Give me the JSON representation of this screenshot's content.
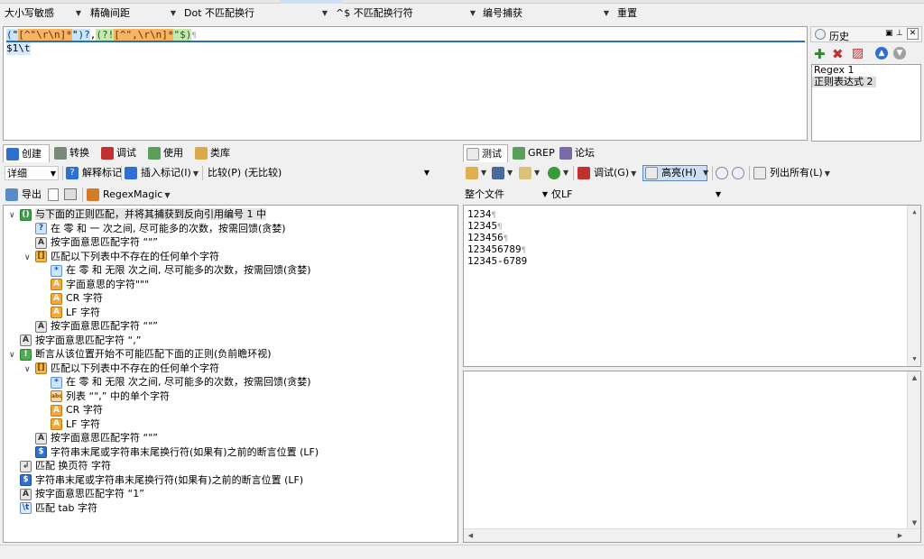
{
  "options": {
    "case": "大小写敏感",
    "spacing": "精确间距",
    "dot": "Dot 不匹配换行",
    "anchors": "^$ 不匹配换行符",
    "capture": "编号捕获",
    "reset": "重置"
  },
  "regex": {
    "line1_tokens": [
      "(",
      "\"",
      "[^\"\\r\\n]*",
      "\"",
      ")?",
      ",",
      "(?!",
      "[^\",\\r\\n]*",
      "\"",
      "$",
      ")"
    ],
    "line2": "$1\\t"
  },
  "history": {
    "title": "历史",
    "items": [
      "Regex 1",
      "正则表达式 2"
    ]
  },
  "left_tabs": [
    "创建",
    "转换",
    "调试",
    "使用",
    "类库"
  ],
  "right_tabs": [
    "测试",
    "GREP",
    "论坛"
  ],
  "left_toolbar": {
    "detail": "详细",
    "explain": "解释标记",
    "insert": "插入标记(I)",
    "compare": "比较(P) (无比较)"
  },
  "left_toolbar2": {
    "export": "导出",
    "regexmagic": "RegexMagic"
  },
  "right_toolbar": {
    "debug": "调试(G)",
    "highlight": "高亮(H)",
    "list_all": "列出所有(L)"
  },
  "right_filters": {
    "scope": "整个文件",
    "lineend": "仅LF"
  },
  "tree": [
    {
      "depth": 0,
      "exp": "∨",
      "badge": "()",
      "kind": "grp",
      "text": "与下面的正则匹配，并将其捕获到反向引用编号 1 中",
      "hl": true
    },
    {
      "depth": 1,
      "exp": "",
      "badge": "?",
      "kind": "rep",
      "text": "在 零 和 一 次之间, 尽可能多的次数，按需回馈(贪婪)"
    },
    {
      "depth": 1,
      "exp": "",
      "badge": "A",
      "kind": "lit",
      "text": "按字面意思匹配字符 “\"”"
    },
    {
      "depth": 1,
      "exp": "∨",
      "badge": "[]",
      "kind": "cls",
      "text": "匹配以下列表中不存在的任何单个字符"
    },
    {
      "depth": 2,
      "exp": "",
      "badge": "*",
      "kind": "rep",
      "text": "在 零 和 无限 次之间, 尽可能多的次数，按需回馈(贪婪)"
    },
    {
      "depth": 2,
      "exp": "",
      "badge": "A",
      "kind": "lit2",
      "text": "字面意思的字符\"\"\""
    },
    {
      "depth": 2,
      "exp": "",
      "badge": "A",
      "kind": "lit2",
      "text": "CR 字符"
    },
    {
      "depth": 2,
      "exp": "",
      "badge": "A",
      "kind": "lit2",
      "text": "LF 字符"
    },
    {
      "depth": 1,
      "exp": "",
      "badge": "A",
      "kind": "lit",
      "text": "按字面意思匹配字符 “\"”"
    },
    {
      "depth": 0,
      "exp": "",
      "badge": "A",
      "kind": "lit",
      "text": "按字面意思匹配字符 “,”"
    },
    {
      "depth": 0,
      "exp": "∨",
      "badge": "!",
      "kind": "look",
      "text": "断言从该位置开始不可能匹配下面的正则(负前瞻环视)"
    },
    {
      "depth": 1,
      "exp": "∨",
      "badge": "[]",
      "kind": "cls",
      "text": "匹配以下列表中不存在的任何单个字符"
    },
    {
      "depth": 2,
      "exp": "",
      "badge": "*",
      "kind": "rep",
      "text": "在 零 和 无限 次之间, 尽可能多的次数，按需回馈(贪婪)"
    },
    {
      "depth": 2,
      "exp": "",
      "badge": "abc",
      "kind": "list",
      "text": "列表 “\",” 中的单个字符"
    },
    {
      "depth": 2,
      "exp": "",
      "badge": "A",
      "kind": "lit2",
      "text": "CR 字符"
    },
    {
      "depth": 2,
      "exp": "",
      "badge": "A",
      "kind": "lit2",
      "text": "LF 字符"
    },
    {
      "depth": 1,
      "exp": "",
      "badge": "A",
      "kind": "lit",
      "text": "按字面意思匹配字符 “\"”"
    },
    {
      "depth": 1,
      "exp": "",
      "badge": "$",
      "kind": "anc",
      "text": "字符串末尾或字符串末尾换行符(如果有)之前的断言位置 (LF)"
    },
    {
      "depth": 0,
      "exp": "",
      "badge": "↲",
      "kind": "gray",
      "text": "匹配 换页符 字符"
    },
    {
      "depth": 0,
      "exp": "",
      "badge": "$",
      "kind": "anc",
      "text": "字符串末尾或字符串末尾换行符(如果有)之前的断言位置 (LF)"
    },
    {
      "depth": 0,
      "exp": "",
      "badge": "A",
      "kind": "lit",
      "text": "按字面意思匹配字符 “1”"
    },
    {
      "depth": 0,
      "exp": "",
      "badge": "\\t",
      "kind": "tab",
      "text": "匹配 tab 字符"
    }
  ],
  "test_lines": [
    "1234",
    "12345",
    "123456",
    "123456789",
    "12345-6789"
  ],
  "colors": {
    "accent": "#2b6cc4",
    "group": "#3aa04a",
    "class": "#f1b64c"
  }
}
